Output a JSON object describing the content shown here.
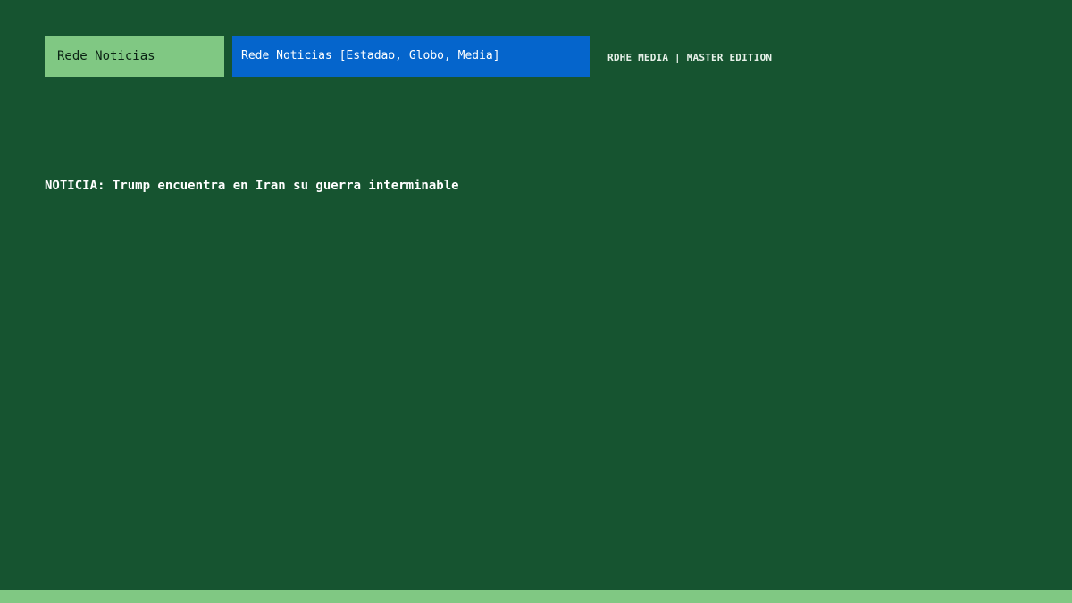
{
  "header": {
    "tab_label": "Rede Noticias",
    "source_selector_value": "Rede Noticias [Estadao, Globo, Media]",
    "brand_label": "RDHE MEDIA | MASTER EDITION"
  },
  "news": {
    "headline": "NOTICIA: Trump encuentra en Iran su guerra interminable"
  },
  "colors": {
    "background": "#165430",
    "tab_background": "#80c883",
    "selector_background": "#0565cc",
    "footer_bar": "#80c883"
  }
}
